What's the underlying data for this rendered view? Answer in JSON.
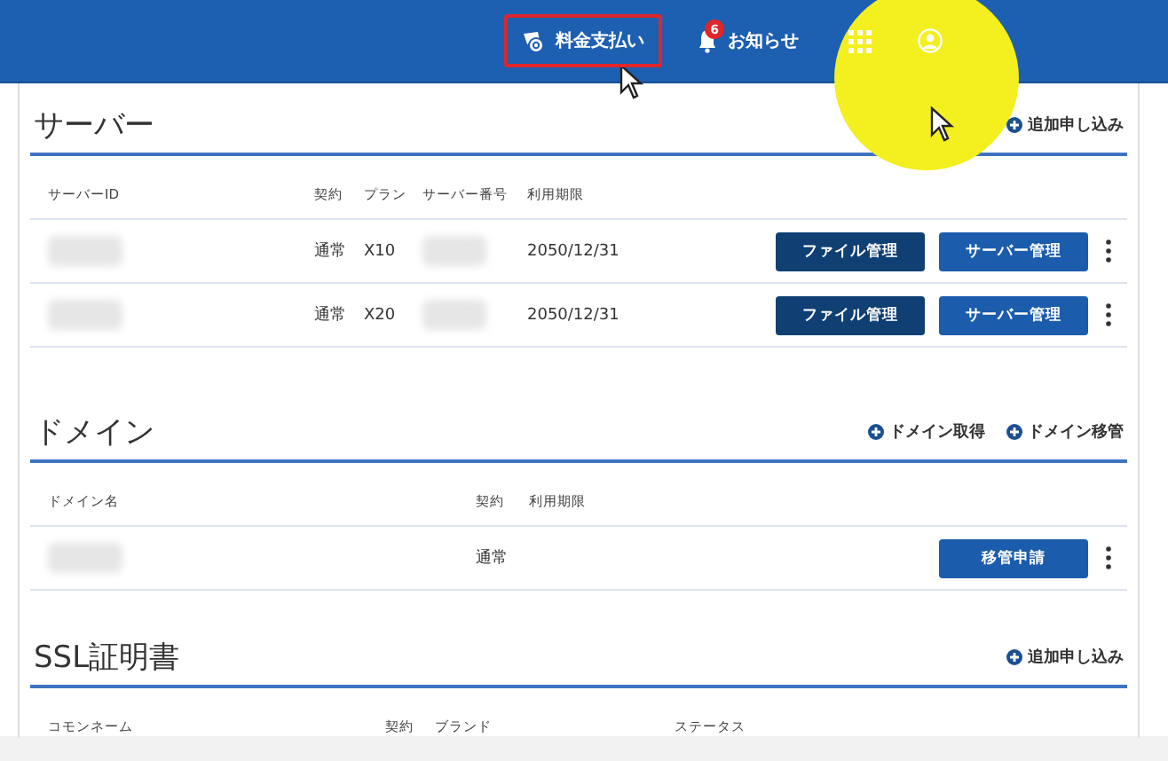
{
  "header": {
    "items": [
      {
        "kind": "billing",
        "label": "料金支払い",
        "selected": true
      },
      {
        "kind": "notice",
        "label": "お知らせ",
        "badge": "6",
        "selected": false
      },
      {
        "kind": "apps"
      },
      {
        "kind": "account"
      }
    ]
  },
  "sections": [
    {
      "kind": "server",
      "title": "サーバー",
      "actions": [
        "追加申し込み"
      ],
      "columns": [
        "サーバーID",
        "契約",
        "プラン",
        "サーバー番号",
        "利用期限"
      ],
      "rows": [
        {
          "id_redacted": true,
          "contract": "通常",
          "plan": "X10",
          "number_redacted": true,
          "expiry": "2050/12/31",
          "buttons": [
            "ファイル管理",
            "サーバー管理"
          ]
        },
        {
          "id_redacted": true,
          "contract": "通常",
          "plan": "X20",
          "number_redacted": true,
          "expiry": "2050/12/31",
          "buttons": [
            "ファイル管理",
            "サーバー管理"
          ]
        }
      ]
    },
    {
      "kind": "domain",
      "title": "ドメイン",
      "actions": [
        "ドメイン取得",
        "ドメイン移管"
      ],
      "columns": [
        "ドメイン名",
        "契約",
        "利用期限"
      ],
      "rows": [
        {
          "id_redacted": true,
          "contract": "通常",
          "buttons": [
            "移管申請"
          ]
        }
      ]
    },
    {
      "kind": "ssl",
      "title": "SSL証明書",
      "actions": [
        "追加申し込み"
      ],
      "columns": [
        "コモンネーム",
        "契約",
        "ブランド",
        "ステータス"
      ]
    }
  ]
}
